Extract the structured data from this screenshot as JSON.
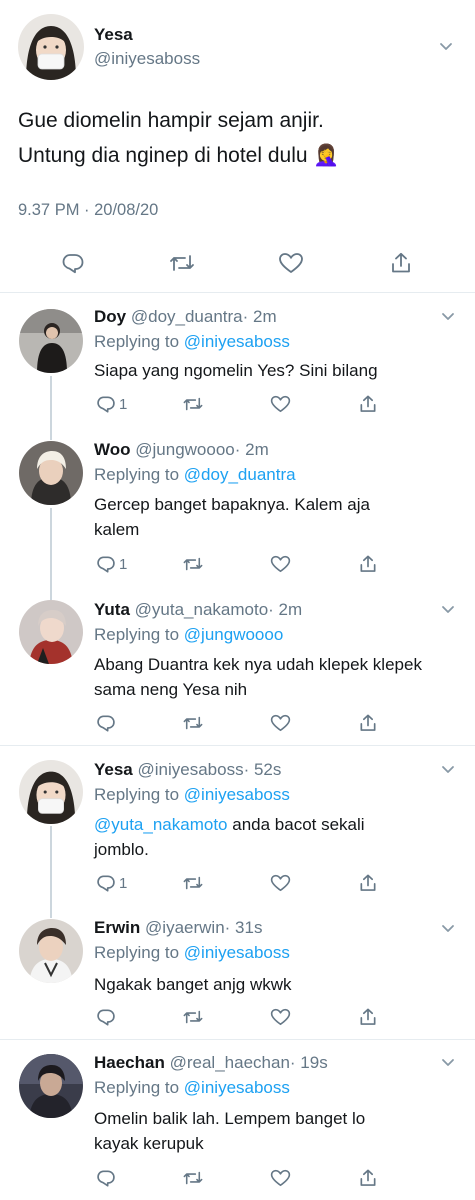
{
  "colors": {
    "link": "#1da1f2",
    "secondary": "#657786",
    "thread": "#ccd6dd",
    "divider": "#e6ecf0"
  },
  "main_tweet": {
    "name": "Yesa",
    "handle": "@iniyesaboss",
    "text_line1": "Gue diomelin hampir sejam anjir.",
    "text_line2": "Untung dia nginep di hotel dulu",
    "emoji": "🤦‍♀️",
    "timestamp": "9.37 PM · 20/08/20",
    "icons": [
      "reply-icon",
      "retweet-icon",
      "like-icon",
      "share-icon"
    ]
  },
  "replies": [
    {
      "name": "Doy",
      "handle": "@doy_duantra",
      "time": "· 2m",
      "replying_prefix": "Replying to",
      "replying_to": "@iniyesaboss",
      "mention": "",
      "text": "Siapa yang ngomelin Yes? Sini bilang",
      "reply_count": "1"
    },
    {
      "name": "Woo",
      "handle": "@jungwoooo",
      "time": "· 2m",
      "replying_prefix": "Replying to",
      "replying_to": "@doy_duantra",
      "mention": "",
      "text": "Gercep banget bapaknya. Kalem aja kalem",
      "reply_count": "1"
    },
    {
      "name": "Yuta",
      "handle": "@yuta_nakamoto",
      "time": "· 2m",
      "replying_prefix": "Replying to",
      "replying_to": "@jungwoooo",
      "mention": "",
      "text": "Abang Duantra kek nya udah klepek klepek sama neng Yesa nih",
      "reply_count": ""
    },
    {
      "name": "Yesa",
      "handle": "@iniyesaboss",
      "time": "· 52s",
      "replying_prefix": "Replying to",
      "replying_to": "@iniyesaboss",
      "mention": "@yuta_nakamoto",
      "text": " anda bacot sekali jomblo.",
      "reply_count": "1"
    },
    {
      "name": "Erwin",
      "handle": "@iyaerwin",
      "time": "· 31s",
      "replying_prefix": "Replying to",
      "replying_to": "@iniyesaboss",
      "mention": "",
      "text": "Ngakak banget anjg wkwk",
      "reply_count": ""
    },
    {
      "name": "Haechan",
      "handle": "@real_haechan",
      "time": "· 19s",
      "replying_prefix": "Replying to",
      "replying_to": "@iniyesaboss",
      "mention": "",
      "text": "Omelin balik lah. Lempem banget lo kayak kerupuk",
      "reply_count": ""
    }
  ]
}
